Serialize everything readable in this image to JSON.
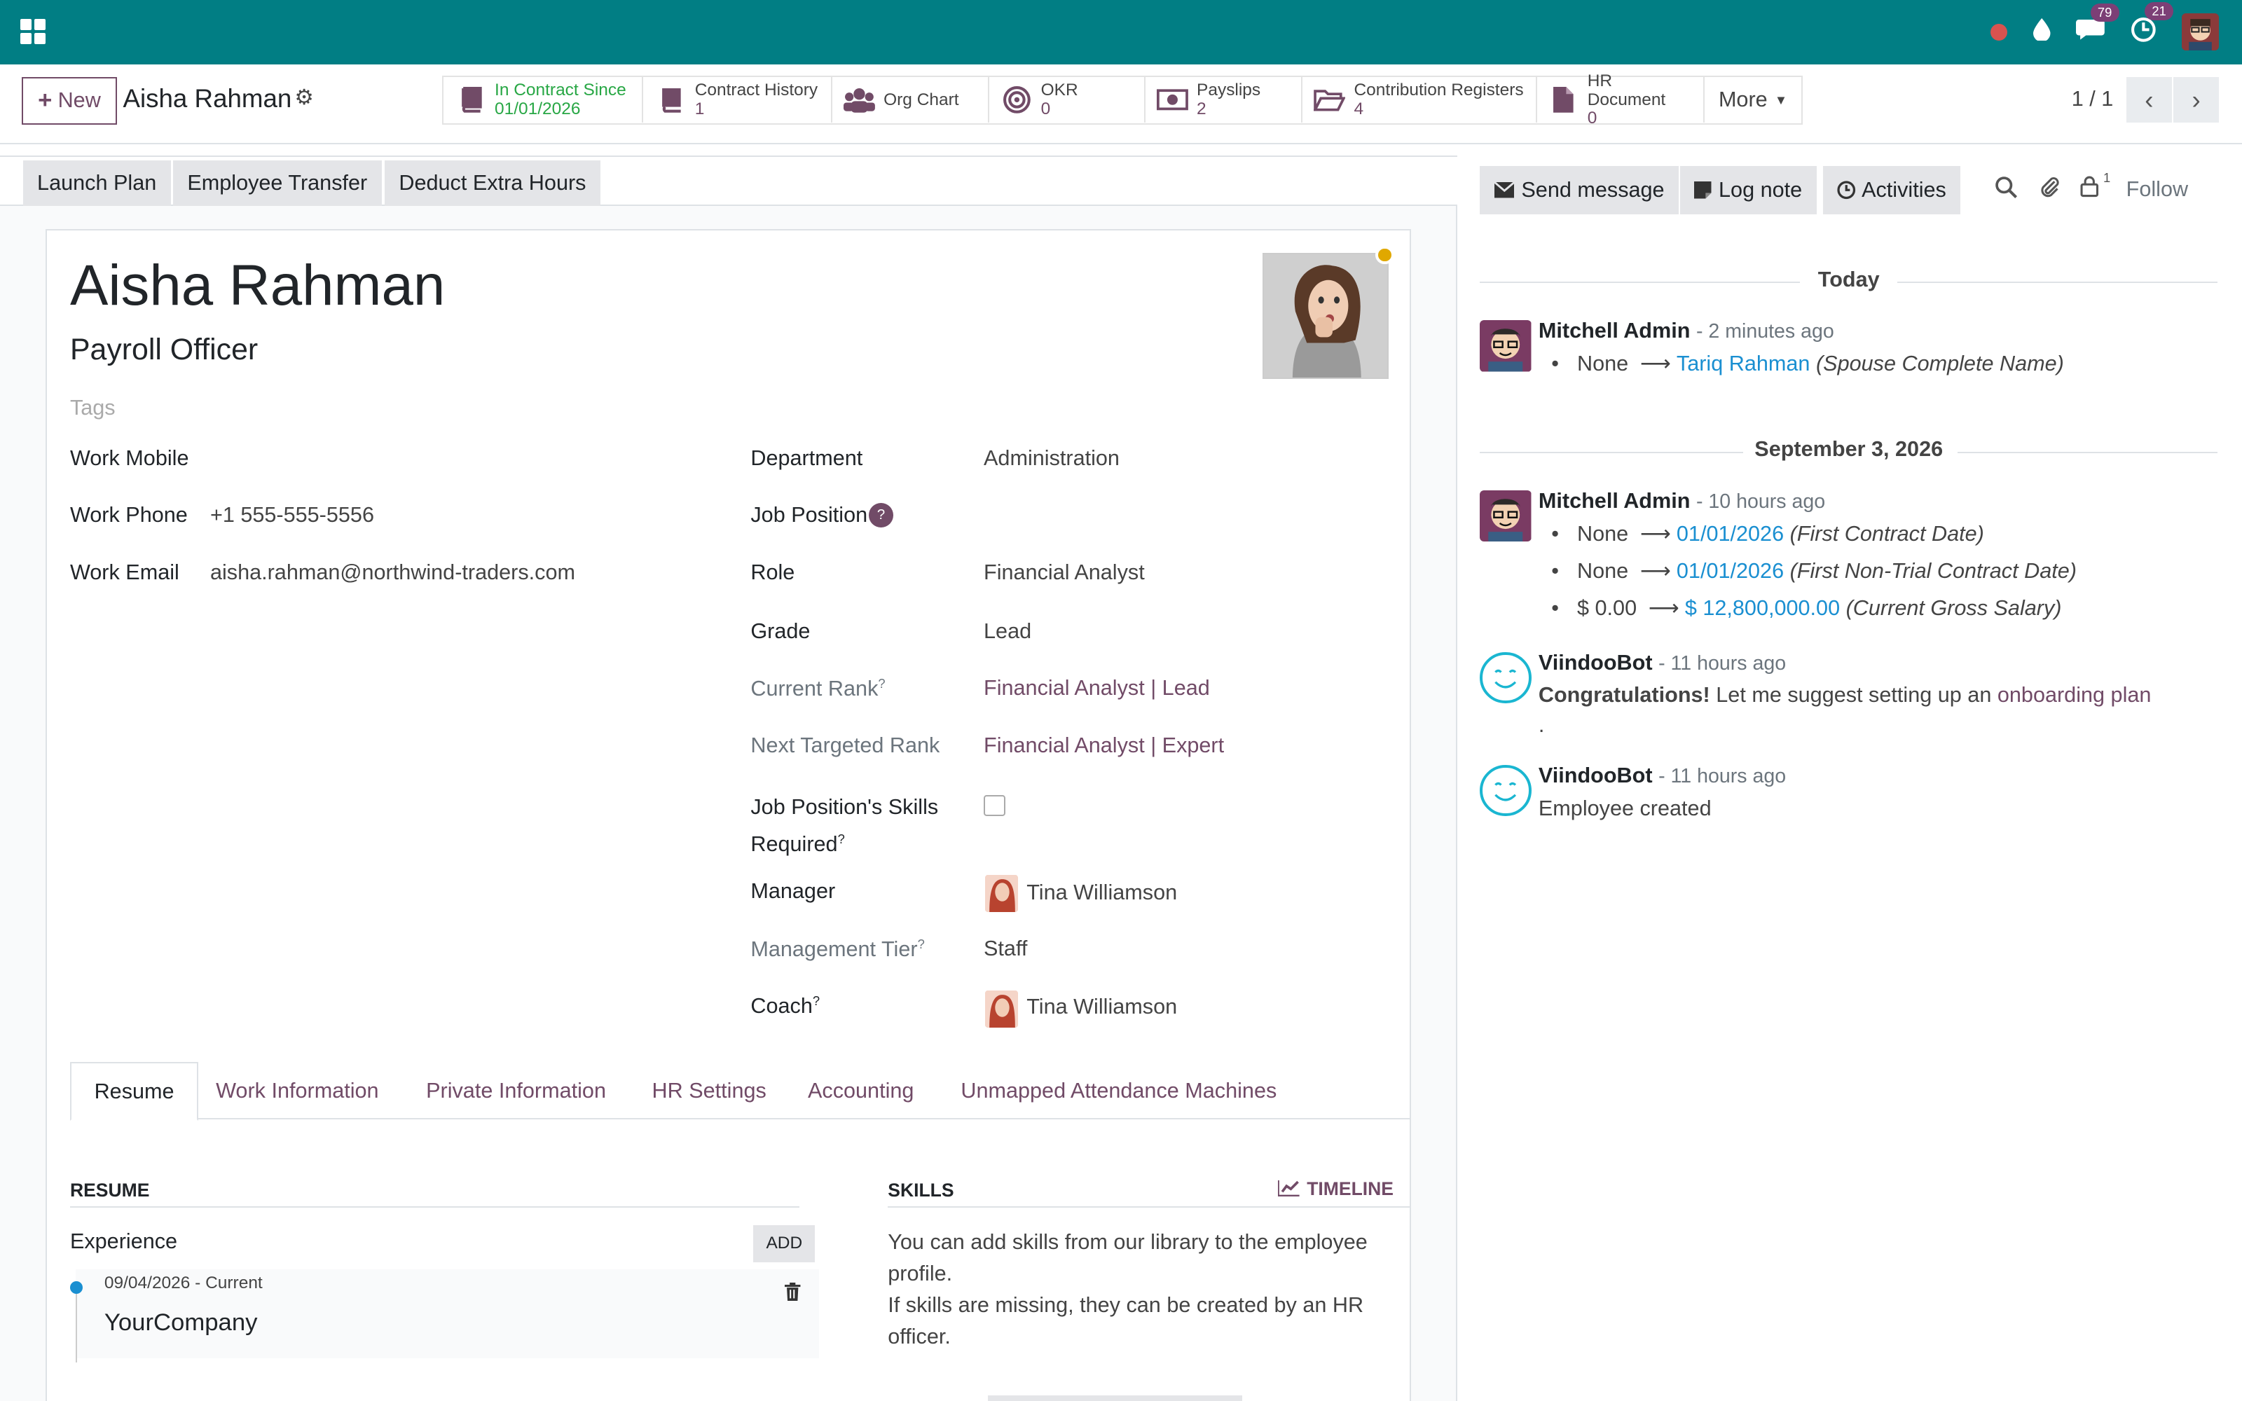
{
  "topbar": {
    "messages_count": "79",
    "activities_count": "21"
  },
  "control_panel": {
    "new_label": "New",
    "record_title": "Aisha Rahman",
    "smart_buttons": [
      {
        "label": "In Contract Since",
        "value": "01/01/2026",
        "icon": "book-icon"
      },
      {
        "label": "Contract History",
        "value": "1",
        "icon": "book-icon"
      },
      {
        "label": "Org Chart",
        "value": "",
        "icon": "users-icon"
      },
      {
        "label": "OKR",
        "value": "0",
        "icon": "target-icon"
      },
      {
        "label": "Payslips",
        "value": "2",
        "icon": "money-icon"
      },
      {
        "label": "Contribution Registers",
        "value": "4",
        "icon": "folder-icon"
      },
      {
        "label": "HR Document",
        "value": "0",
        "icon": "file-icon"
      }
    ],
    "more_label": "More",
    "pager": "1 / 1"
  },
  "statusbar": {
    "buttons": [
      "Launch Plan",
      "Employee Transfer",
      "Deduct Extra Hours"
    ]
  },
  "employee": {
    "name": "Aisha Rahman",
    "job_title": "Payroll Officer",
    "tags_placeholder": "Tags",
    "work_mobile_label": "Work Mobile",
    "work_mobile": "",
    "work_phone_label": "Work Phone",
    "work_phone": "+1 555-555-5556",
    "work_email_label": "Work Email",
    "work_email": "aisha.rahman@northwind-traders.com",
    "department_label": "Department",
    "department": "Administration",
    "job_position_label": "Job Position",
    "job_position_help": "?",
    "role_label": "Role",
    "role": "Financial Analyst",
    "grade_label": "Grade",
    "grade": "Lead",
    "current_rank_label": "Current Rank",
    "current_rank": "Financial Analyst | Lead",
    "next_rank_label": "Next Targeted Rank",
    "next_rank": "Financial Analyst | Expert",
    "skills_required_label_1": "Job Position's Skills",
    "skills_required_label_2": "Required",
    "manager_label": "Manager",
    "manager": "Tina Williamson",
    "management_tier_label": "Management Tier",
    "management_tier": "Staff",
    "coach_label": "Coach",
    "coach": "Tina Williamson",
    "sup_mark": "?"
  },
  "tabs": [
    "Resume",
    "Work Information",
    "Private Information",
    "HR Settings",
    "Accounting",
    "Unmapped Attendance Machines"
  ],
  "resume": {
    "title": "RESUME",
    "experience_label": "Experience",
    "add_label": "ADD",
    "item_dates": "09/04/2026 - Current",
    "item_company": "YourCompany"
  },
  "skills": {
    "title": "SKILLS",
    "timeline_label": "TIMELINE",
    "text_1": "You can add skills from our library to the employee profile.",
    "text_2": "If skills are missing, they can be created by an HR officer."
  },
  "chatter": {
    "send_message": "Send message",
    "log_note": "Log note",
    "activities": "Activities",
    "followers_count": "1",
    "follow": "Follow",
    "day1": "Today",
    "day2": "September 3, 2026",
    "m1_author": "Mitchell Admin",
    "m1_ago": "- 2 minutes ago",
    "m1_old": "None",
    "m1_new": "Tariq Rahman",
    "m1_field": "(Spouse Complete Name)",
    "m2_author": "Mitchell Admin",
    "m2_ago": "- 10 hours ago",
    "m2_c1_old": "None",
    "m2_c1_new": "01/01/2026",
    "m2_c1_field": "(First Contract Date)",
    "m2_c2_old": "None",
    "m2_c2_new": "01/01/2026",
    "m2_c2_field": "(First Non-Trial Contract Date)",
    "m2_c3_old": "$ 0.00",
    "m2_c3_new": "$ 12,800,000.00",
    "m2_c3_field": "(Current Gross Salary)",
    "m3_author": "ViindooBot",
    "m3_ago": "- 11 hours ago",
    "m3_bold": "Congratulations!",
    "m3_text": "Let me suggest setting up an",
    "m3_link": "onboarding plan",
    "m3_dot": ".",
    "m4_author": "ViindooBot",
    "m4_ago": "- 11 hours ago",
    "m4_text": "Employee created"
  },
  "colors": {
    "brand": "#017e84",
    "accent": "#714b67",
    "link_blue": "#1a8fd1"
  }
}
